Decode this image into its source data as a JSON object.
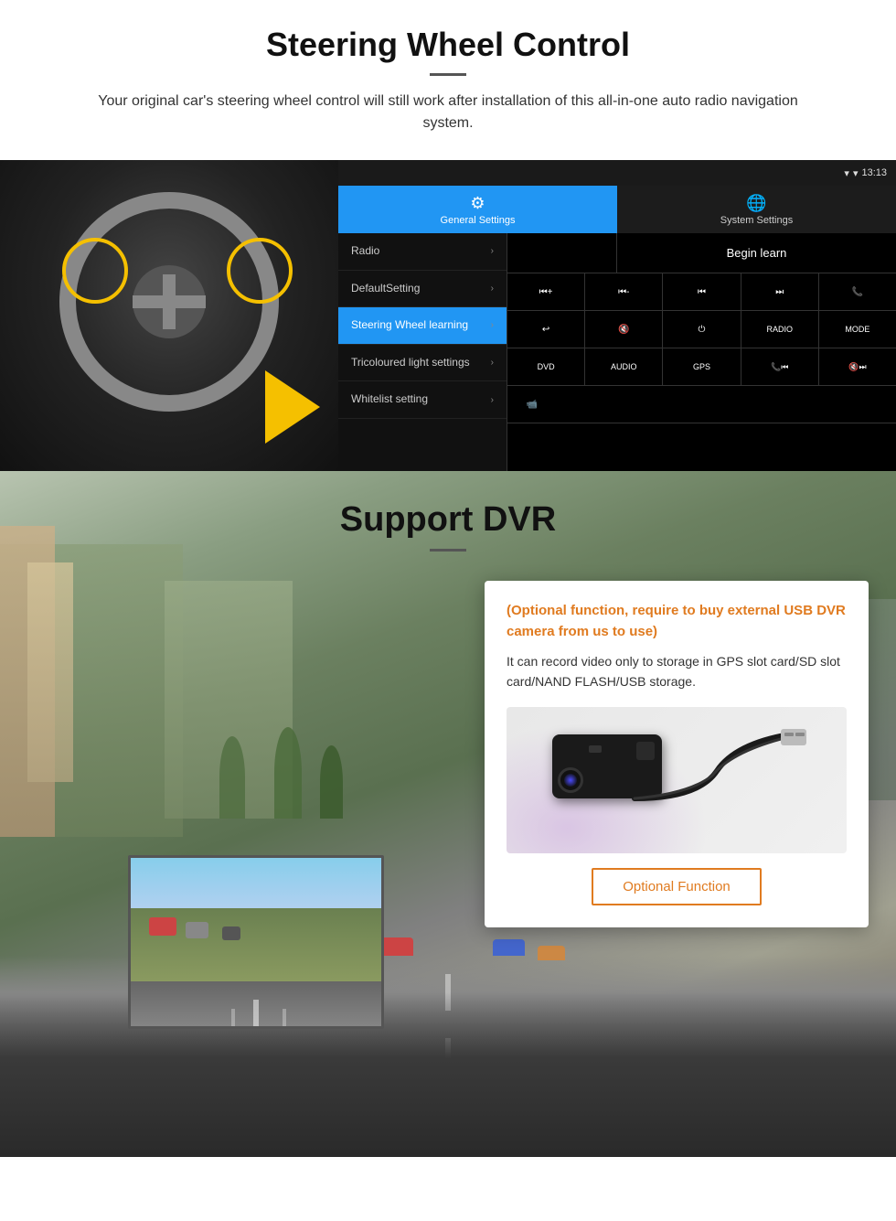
{
  "page": {
    "section1": {
      "title": "Steering Wheel Control",
      "description": "Your original car's steering wheel control will still work after installation of this all-in-one auto radio navigation system.",
      "android_ui": {
        "status_time": "13:13",
        "tab1_label": "General Settings",
        "tab2_label": "System Settings",
        "menu_items": [
          {
            "label": "Radio",
            "active": false
          },
          {
            "label": "DefaultSetting",
            "active": false
          },
          {
            "label": "Steering Wheel learning",
            "active": true
          },
          {
            "label": "Tricoloured light settings",
            "active": false
          },
          {
            "label": "Whitelist setting",
            "active": false
          }
        ],
        "begin_learn_label": "Begin learn",
        "control_buttons_row1": [
          "⏮+",
          "⏮-",
          "⏮⏮",
          "⏭⏭",
          "📞"
        ],
        "control_buttons_row2": [
          "↩",
          "🔇",
          "⏻",
          "RADIO",
          "MODE"
        ],
        "control_buttons_row3": [
          "DVD",
          "AUDIO",
          "GPS",
          "📞⏮⏮",
          "🔇⏭⏭"
        ],
        "control_buttons_row4": [
          "📹"
        ]
      }
    },
    "section2": {
      "title": "Support DVR",
      "optional_text": "(Optional function, require to buy external USB DVR camera from us to use)",
      "description": "It can record video only to storage in GPS slot card/SD slot card/NAND FLASH/USB storage.",
      "optional_function_label": "Optional Function"
    }
  }
}
